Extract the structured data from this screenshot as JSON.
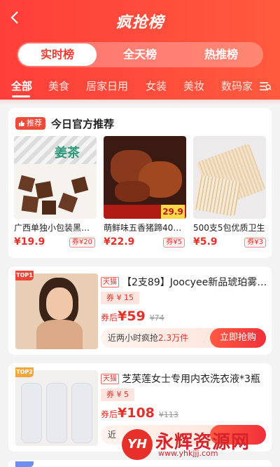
{
  "header": {
    "title": "疯抢榜",
    "segments": [
      "实时榜",
      "全天榜",
      "热推榜"
    ],
    "active_segment": 0
  },
  "categories": [
    "全部",
    "美食",
    "居家日用",
    "女装",
    "美妆",
    "数码家"
  ],
  "recommend": {
    "badge": "推荐",
    "title": "今日官方推荐",
    "items": [
      {
        "name": "广西单独小包装黑…",
        "price": "¥19.9",
        "coupon": "券¥20",
        "img_text": "姜茶"
      },
      {
        "name": "萌鲜味五香猪蹄40…",
        "price": "¥22.9",
        "coupon": "券¥5",
        "img_text": "29.9"
      },
      {
        "name": "500支5包优质卫生…",
        "price": "¥5.9",
        "coupon": "券¥3",
        "img_text": ""
      }
    ]
  },
  "products": [
    {
      "rank": "TOP1",
      "shop": "天猫",
      "title": "【2支89】Joocyee新品琥珀雾…",
      "coupon": "券 ¥ 15",
      "after_label": "券后",
      "price": "¥59",
      "orig": "¥74",
      "grab_prefix": "近两小时疯抢",
      "grab_count": "2.3万件",
      "button": "立即抢购"
    },
    {
      "rank": "TOP2",
      "shop": "天猫",
      "title": "芝芙莲女士专用内衣洗衣液*3瓶",
      "coupon": "券 ¥ 5",
      "after_label": "券后",
      "price": "¥108",
      "orig": "¥113",
      "grab_prefix": "近",
      "grab_count": "",
      "button": ""
    }
  ],
  "watermark": {
    "logo": "YH",
    "text": "永辉资源网",
    "url": "www.yhkjjj.com"
  },
  "colors": {
    "accent": "#f23a33",
    "price": "#e8302a"
  }
}
